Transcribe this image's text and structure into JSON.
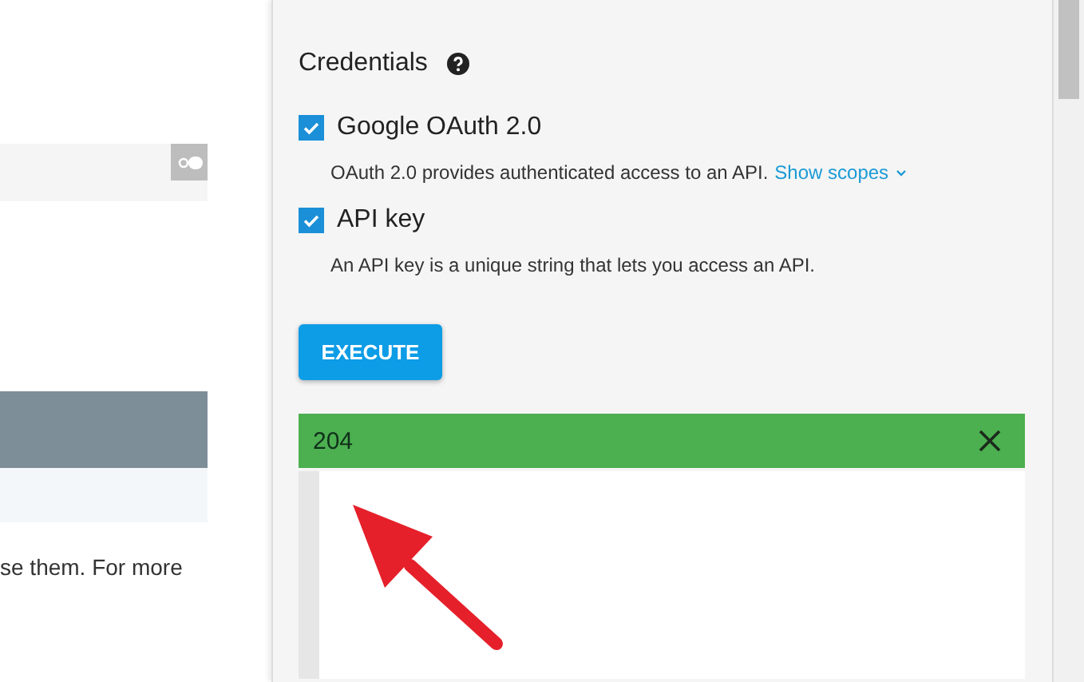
{
  "left_pane": {
    "paragraph_fragment": "se them. For more"
  },
  "credentials": {
    "title": "Credentials",
    "items": [
      {
        "kind": "checkbox",
        "label": "Google OAuth 2.0",
        "checked": true,
        "description": "OAuth 2.0 provides authenticated access to an API.",
        "link": "Show scopes"
      },
      {
        "kind": "checkbox",
        "label": "API key",
        "checked": true,
        "description": "An API key is a unique string that lets you access an API."
      }
    ]
  },
  "execute_button": "EXECUTE",
  "response": {
    "status": "204"
  }
}
